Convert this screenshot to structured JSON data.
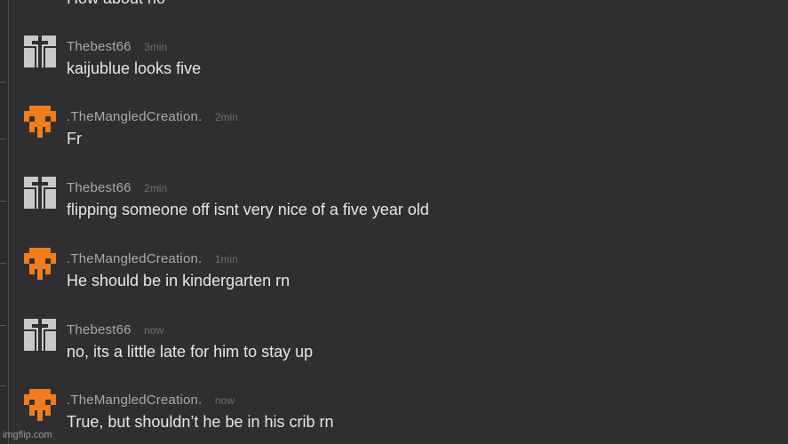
{
  "chat": {
    "partial_top_message": "How about no",
    "messages": [
      {
        "username": "Thebest66",
        "time": "3min",
        "text": "kaijublue looks five",
        "avatar": "thebest66-avatar-icon"
      },
      {
        "username": ".TheMangledCreation.",
        "time": "2min",
        "text": "Fr",
        "avatar": "mangled-creation-avatar-icon"
      },
      {
        "username": "Thebest66",
        "time": "2min",
        "text": "flipping someone off isnt very nice of a five year old",
        "avatar": "thebest66-avatar-icon"
      },
      {
        "username": ".TheMangledCreation.",
        "time": "1min",
        "text": "He should be in kindergarten rn",
        "avatar": "mangled-creation-avatar-icon"
      },
      {
        "username": "Thebest66",
        "time": "now",
        "text": "no, its a little late for him to stay up",
        "avatar": "thebest66-avatar-icon"
      },
      {
        "username": ".TheMangledCreation.",
        "time": "now",
        "text": "True, but shouldn’t he be in his crib rn",
        "avatar": "mangled-creation-avatar-icon"
      }
    ]
  },
  "watermark": "imgflip.com",
  "colors": {
    "background": "#2f2f31",
    "username": "#a9a9ab",
    "timestamp": "#6f6f72",
    "message_text": "#e6e6e8",
    "avatar_grey": "#c9c9cb",
    "avatar_orange": "#f07c1c"
  }
}
